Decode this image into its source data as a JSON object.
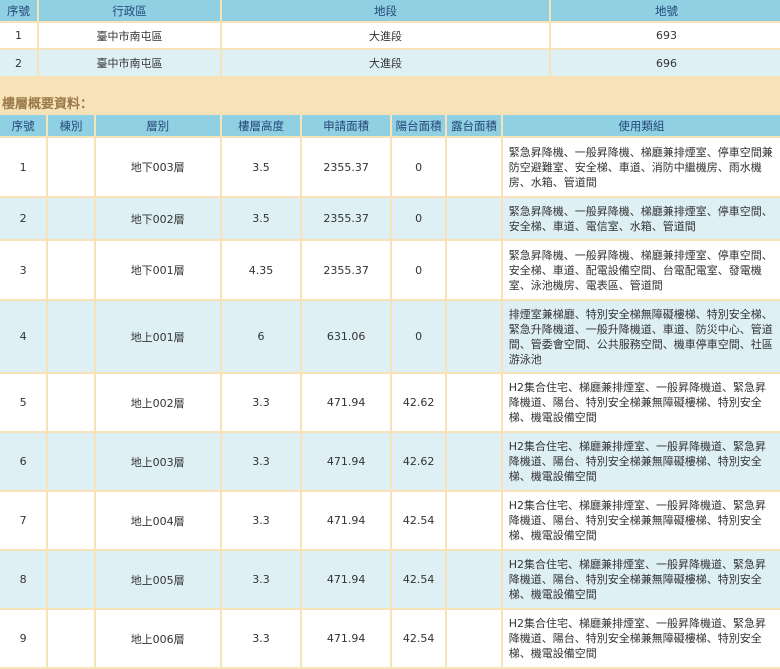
{
  "land_table": {
    "headers": [
      "序號",
      "行政區",
      "地段",
      "地號"
    ],
    "rows": [
      {
        "no": "1",
        "district": "臺中市南屯區",
        "section": "大進段",
        "lot": "693"
      },
      {
        "no": "2",
        "district": "臺中市南屯區",
        "section": "大進段",
        "lot": "696"
      }
    ]
  },
  "floor_section": {
    "title": "樓層概要資料：",
    "headers": [
      "序號",
      "棟別",
      "層別",
      "樓層高度",
      "申請面積",
      "陽台面積",
      "露台面積",
      "使用類組"
    ],
    "rows": [
      {
        "no": "1",
        "building": "",
        "floor": "地下003層",
        "height": "3.5",
        "area": "2355.37",
        "balcony": "0",
        "terrace": "",
        "usage": "緊急昇降機、一般昇降機、梯廳兼排煙室、停車空間兼防空避難室、安全梯、車道、消防中繼機房、雨水機房、水箱、管道間"
      },
      {
        "no": "2",
        "building": "",
        "floor": "地下002層",
        "height": "3.5",
        "area": "2355.37",
        "balcony": "0",
        "terrace": "",
        "usage": "緊急昇降機、一般昇降機、梯廳兼排煙室、停車空間、安全梯、車道、電信室、水箱、管道間"
      },
      {
        "no": "3",
        "building": "",
        "floor": "地下001層",
        "height": "4.35",
        "area": "2355.37",
        "balcony": "0",
        "terrace": "",
        "usage": "緊急昇降機、一般昇降機、梯廳兼排煙室、停車空間、安全梯、車道、配電設備空間、台電配電室、發電機室、泳池機房、電表區、管道間"
      },
      {
        "no": "4",
        "building": "",
        "floor": "地上001層",
        "height": "6",
        "area": "631.06",
        "balcony": "0",
        "terrace": "",
        "usage": "排煙室兼梯廳、特別安全梯無障礙樓梯、特別安全梯、緊急升降機道、一般升降機道、車道、防災中心、管道間、管委會空間、公共服務空間、機車停車空間、社區游泳池"
      },
      {
        "no": "5",
        "building": "",
        "floor": "地上002層",
        "height": "3.3",
        "area": "471.94",
        "balcony": "42.62",
        "terrace": "",
        "usage": "H2集合住宅、梯廳兼排煙室、一般昇降機道、緊急昇降機道、陽台、特別安全梯兼無障礙樓梯、特別安全梯、機電設備空間"
      },
      {
        "no": "6",
        "building": "",
        "floor": "地上003層",
        "height": "3.3",
        "area": "471.94",
        "balcony": "42.62",
        "terrace": "",
        "usage": "H2集合住宅、梯廳兼排煙室、一般昇降機道、緊急昇降機道、陽台、特別安全梯兼無障礙樓梯、特別安全梯、機電設備空間"
      },
      {
        "no": "7",
        "building": "",
        "floor": "地上004層",
        "height": "3.3",
        "area": "471.94",
        "balcony": "42.54",
        "terrace": "",
        "usage": "H2集合住宅、梯廳兼排煙室、一般昇降機道、緊急昇降機道、陽台、特別安全梯兼無障礙樓梯、特別安全梯、機電設備空間"
      },
      {
        "no": "8",
        "building": "",
        "floor": "地上005層",
        "height": "3.3",
        "area": "471.94",
        "balcony": "42.54",
        "terrace": "",
        "usage": "H2集合住宅、梯廳兼排煙室、一般昇降機道、緊急昇降機道、陽台、特別安全梯兼無障礙樓梯、特別安全梯、機電設備空間"
      },
      {
        "no": "9",
        "building": "",
        "floor": "地上006層",
        "height": "3.3",
        "area": "471.94",
        "balcony": "42.54",
        "terrace": "",
        "usage": "H2集合住宅、梯廳兼排煙室、一般昇降機道、緊急昇降機道、陽台、特別安全梯兼無障礙樓梯、特別安全梯、機電設備空間"
      }
    ]
  },
  "colors": {
    "page_background": "#f8e2b8",
    "header_background": "#8fd0e2",
    "header_text": "#25477a",
    "row_white": "#ffffff",
    "row_blue": "#dff0f5",
    "section_title": "#9a7a4a"
  }
}
